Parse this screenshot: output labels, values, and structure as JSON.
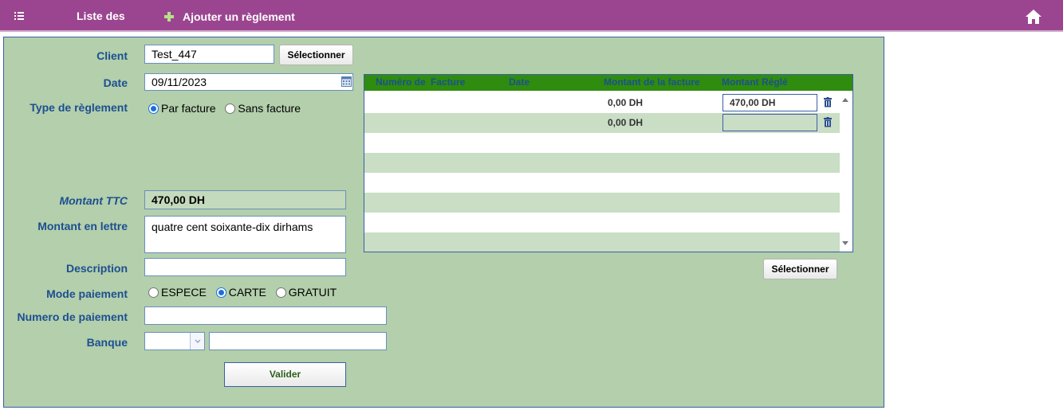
{
  "topbar": {
    "list_label": "Liste des",
    "add_label": "Ajouter un règlement"
  },
  "form": {
    "client_label": "Client",
    "client_value": "Test_447",
    "select_client_label": "Sélectionner",
    "date_label": "Date",
    "date_value": "09/11/2023",
    "type_label": "Type de règlement",
    "type_options": [
      "Par facture",
      "Sans facture"
    ],
    "type_selected": "Par facture",
    "montant_ttc_label": "Montant TTC",
    "montant_ttc_value": "470,00 DH",
    "montant_lettre_label": "Montant en lettre",
    "montant_lettre_value": "quatre cent soixante-dix dirhams",
    "description_label": "Description",
    "description_value": "",
    "mode_label": "Mode paiement",
    "mode_options": [
      "ESPECE",
      "CARTE",
      "GRATUIT"
    ],
    "mode_selected": "CARTE",
    "numero_label": "Numero de paiement",
    "numero_value": "",
    "banque_label": "Banque",
    "banque_value": "",
    "valider_label": "Valider"
  },
  "invoices": {
    "headers": [
      "Numéro de",
      "Facture",
      "Date",
      "Montant de la facture",
      "Montant Réglé"
    ],
    "rows": [
      {
        "montant_facture": "0,00 DH",
        "montant_regle": "470,00 DH"
      },
      {
        "montant_facture": "0,00 DH",
        "montant_regle": ""
      }
    ],
    "select_label": "Sélectionner"
  },
  "colors": {
    "topbar": "#9b4590",
    "panel": "#b3cfab",
    "table_header": "#2f8c0e",
    "label_text": "#1d4f91"
  }
}
